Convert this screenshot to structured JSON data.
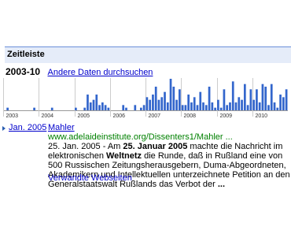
{
  "panel": {
    "title": "Zeitleiste",
    "range_label": "2003-10",
    "range_link": "Andere Daten durchsuchen"
  },
  "timeline": {
    "year_labels": [
      "2003",
      "2004",
      "2005",
      "2006",
      "2007",
      "2008",
      "2009",
      "2010"
    ],
    "bar_color": "#3366cc",
    "grid_color": "#cccccc",
    "baseline_color": "#999999",
    "month_counts": [
      0,
      1,
      0,
      0,
      0,
      0,
      0,
      0,
      0,
      0,
      1,
      0,
      0,
      0,
      0,
      0,
      1,
      0,
      0,
      0,
      0,
      0,
      0,
      0,
      1,
      0,
      0,
      1,
      6,
      3,
      4,
      6,
      2,
      3,
      2,
      1,
      0,
      0,
      0,
      0,
      2,
      1,
      0,
      0,
      2,
      0,
      1,
      2,
      5,
      4,
      6,
      9,
      4,
      5,
      7,
      3,
      12,
      9,
      4,
      8,
      2,
      2,
      6,
      3,
      5,
      2,
      7,
      3,
      2,
      9,
      3,
      1,
      4,
      1,
      8,
      2,
      3,
      11,
      3,
      5,
      4,
      10,
      2,
      8,
      4,
      8,
      3,
      10,
      9,
      2,
      10,
      3,
      1,
      6,
      5,
      8
    ],
    "max_count": 12
  },
  "result": {
    "date": "Jan. 2005",
    "title": "Mahler",
    "url": "www.adelaideinstitute.org/Dissenters1/Mahler ...",
    "snippet": {
      "part1": "25. Jan. 2005 - Am ",
      "bold1": "25. Januar 2005",
      "part2": " machte die Nachricht im elektronischen ",
      "bold2": "Weltnetz",
      "part3": " die Runde, daß in Rußland eine von 500 Russischen Zeitungsherausgebern, Duma-Abgeordneten, Akademikern und Intellektuellen unterzeichnete Petition an den Generalstaatswalt Rußlands das Verbot der ",
      "bold3": "..."
    },
    "related_link": "Verwandte Webseiten"
  }
}
